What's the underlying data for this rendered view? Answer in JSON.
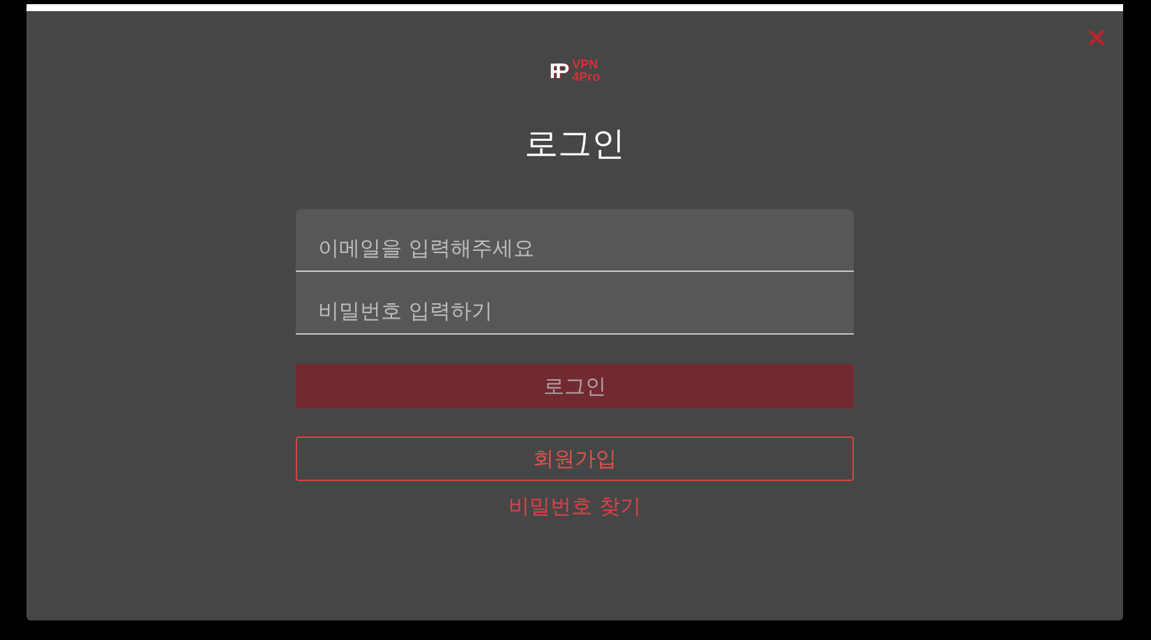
{
  "logo": {
    "monogram": "FP",
    "lines": [
      "VPN",
      "4Pro"
    ]
  },
  "title": "로그인",
  "fields": [
    {
      "placeholder": "이메일을 입력해주세요"
    },
    {
      "placeholder": "비밀번호 입력하기"
    }
  ],
  "login_button": {
    "label": "로그인",
    "disabled": true
  },
  "signup_button": {
    "label": "회원가입"
  },
  "forgot_link": "비밀번호 찾기"
}
